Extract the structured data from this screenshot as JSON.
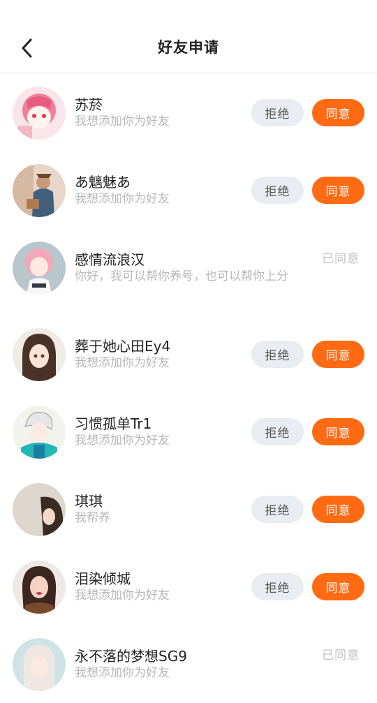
{
  "header": {
    "title": "好友申请",
    "back_icon": "chevron-left-icon"
  },
  "requests": [
    {
      "name": "苏菸",
      "message": "我想添加你为好友",
      "status": "pending",
      "reject_label": "拒绝",
      "accept_label": "同意"
    },
    {
      "name": "あ魑魅あ",
      "message": "我想添加你为好友",
      "status": "pending",
      "reject_label": "拒绝",
      "accept_label": "同意"
    },
    {
      "name": "感情流浪汉",
      "message": "你好，我可以帮你养号，也可以帮你上分",
      "status": "accepted",
      "status_label": "已同意"
    },
    {
      "name": "葬于她心田Ey4",
      "message": "我想添加你为好友",
      "status": "pending",
      "reject_label": "拒绝",
      "accept_label": "同意"
    },
    {
      "name": "习惯孤单Tr1",
      "message": "我想添加你为好友",
      "status": "pending",
      "reject_label": "拒绝",
      "accept_label": "同意"
    },
    {
      "name": "琪琪",
      "message": "我帮养",
      "status": "pending",
      "reject_label": "拒绝",
      "accept_label": "同意"
    },
    {
      "name": "泪染倾城",
      "message": "我想添加你为好友",
      "status": "pending",
      "reject_label": "拒绝",
      "accept_label": "同意"
    },
    {
      "name": "永不落的梦想SG9",
      "message": "我想添加你为好友",
      "status": "accepted",
      "status_label": "已同意"
    }
  ],
  "colors": {
    "accent": "#ff6a13",
    "reject_bg": "#e9ecf0",
    "muted": "#b8b8b8"
  }
}
